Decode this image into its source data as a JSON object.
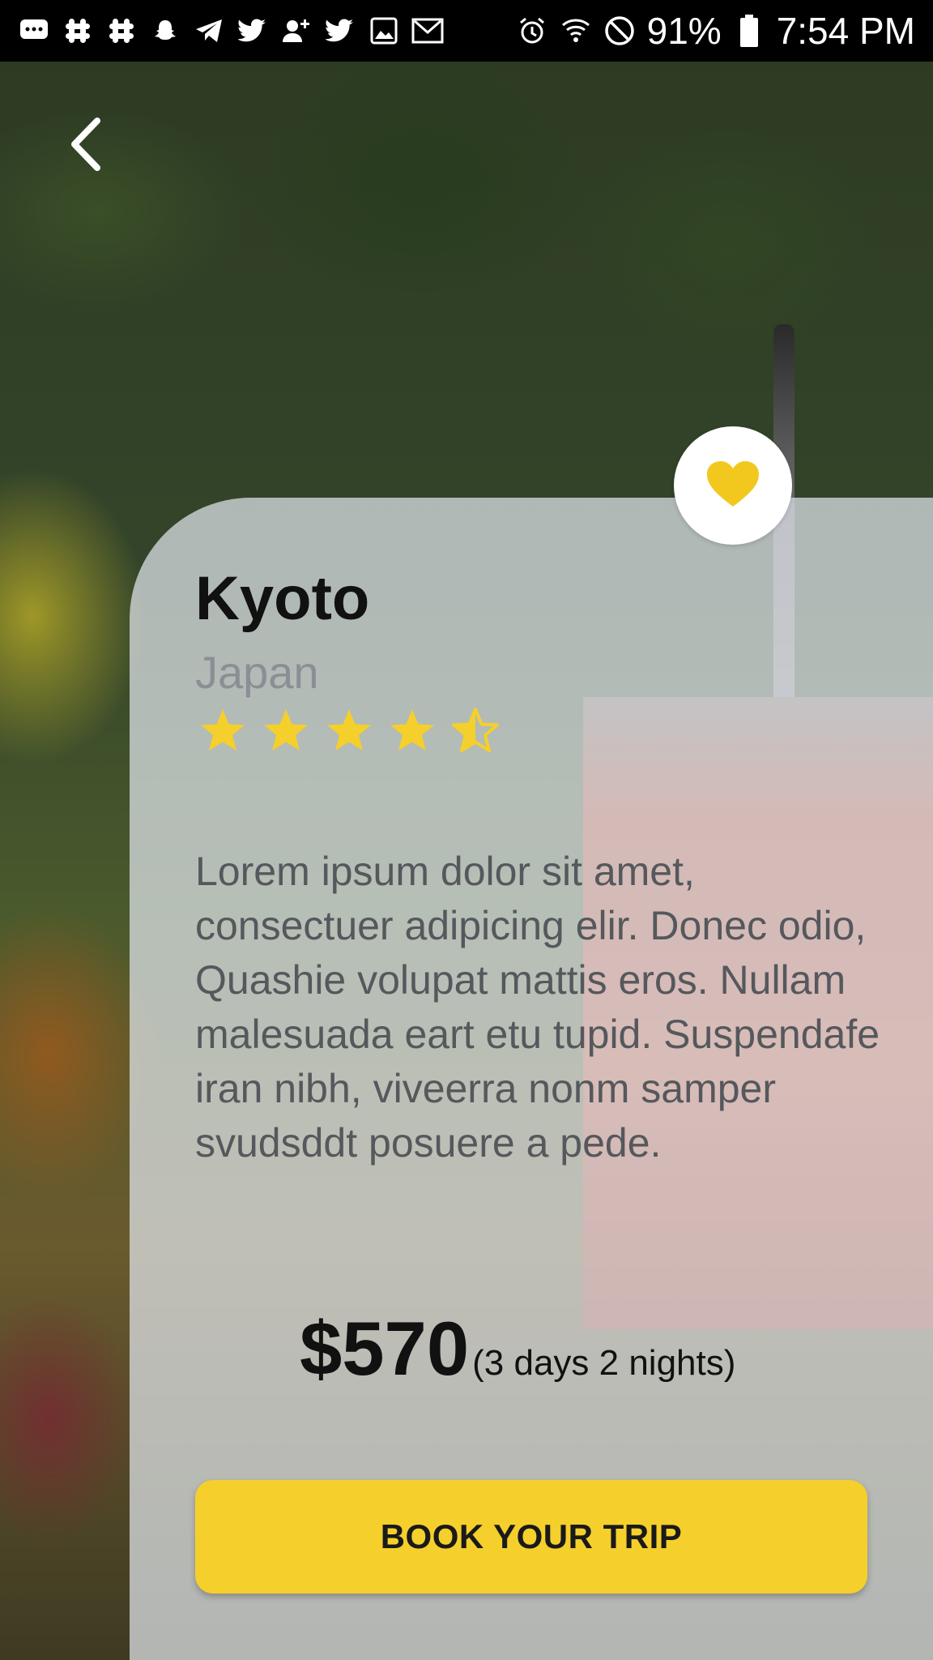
{
  "status_bar": {
    "battery": "91%",
    "time": "7:54 PM",
    "left_icons": [
      "messages-icon",
      "slack-icon",
      "slack-icon",
      "snapchat-icon",
      "telegram-icon",
      "twitter-icon",
      "add-contact-icon",
      "twitter-icon",
      "gallery-icon",
      "gmail-icon"
    ],
    "right_icons": [
      "alarm-icon",
      "wifi-icon",
      "do-not-disturb-icon",
      "battery-icon"
    ]
  },
  "destination": {
    "title": "Kyoto",
    "country": "Japan",
    "rating": 4.5,
    "rating_max": 5,
    "description": "Lorem ipsum dolor sit amet, consectuer adipicing elir. Donec odio, Quashie volupat mattis eros. Nullam malesuada eart etu tupid. Suspendafe iran nibh, viveerra nonm samper svudsddt posuere a pede.",
    "price": "$570",
    "duration": "(3 days 2 nights)",
    "cta_label": "BOOK YOUR TRIP",
    "favorited": true
  },
  "colors": {
    "accent": "#f5cf2b",
    "card": "#e1e6eb",
    "heart": "#f2c81f"
  }
}
